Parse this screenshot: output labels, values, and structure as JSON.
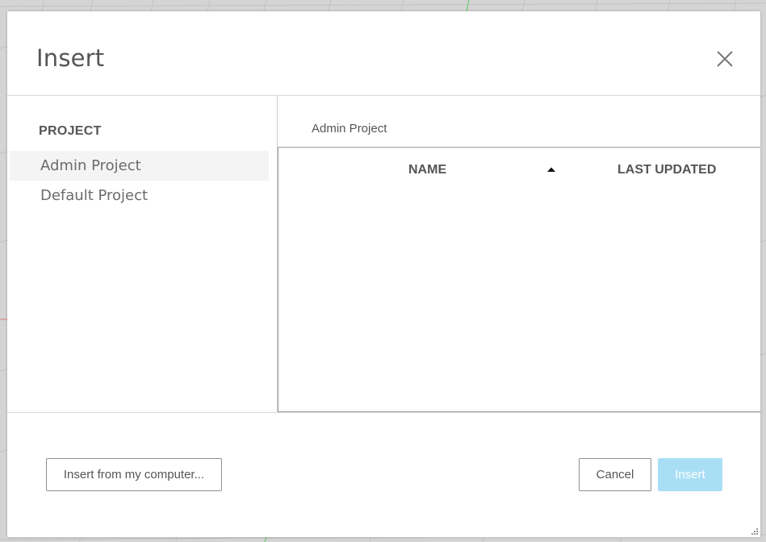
{
  "dialog": {
    "title": "Insert",
    "close_icon": "close-icon"
  },
  "sidebar": {
    "heading": "PROJECT",
    "items": [
      {
        "label": "Admin Project",
        "selected": true
      },
      {
        "label": "Default Project",
        "selected": false
      }
    ]
  },
  "main": {
    "breadcrumb": "Admin Project",
    "columns": [
      {
        "label": "NAME",
        "sort": "ascending",
        "sort_icon": "sort-ascending-icon"
      },
      {
        "label": "LAST UPDATED"
      }
    ],
    "rows": []
  },
  "footer": {
    "upload_label": "Insert from my computer...",
    "cancel_label": "Cancel",
    "insert_label": "Insert",
    "insert_disabled": true
  },
  "colors": {
    "accent_disabled": "#a9dff5",
    "text": "#555555",
    "selected_background": "#f4f4f5"
  }
}
